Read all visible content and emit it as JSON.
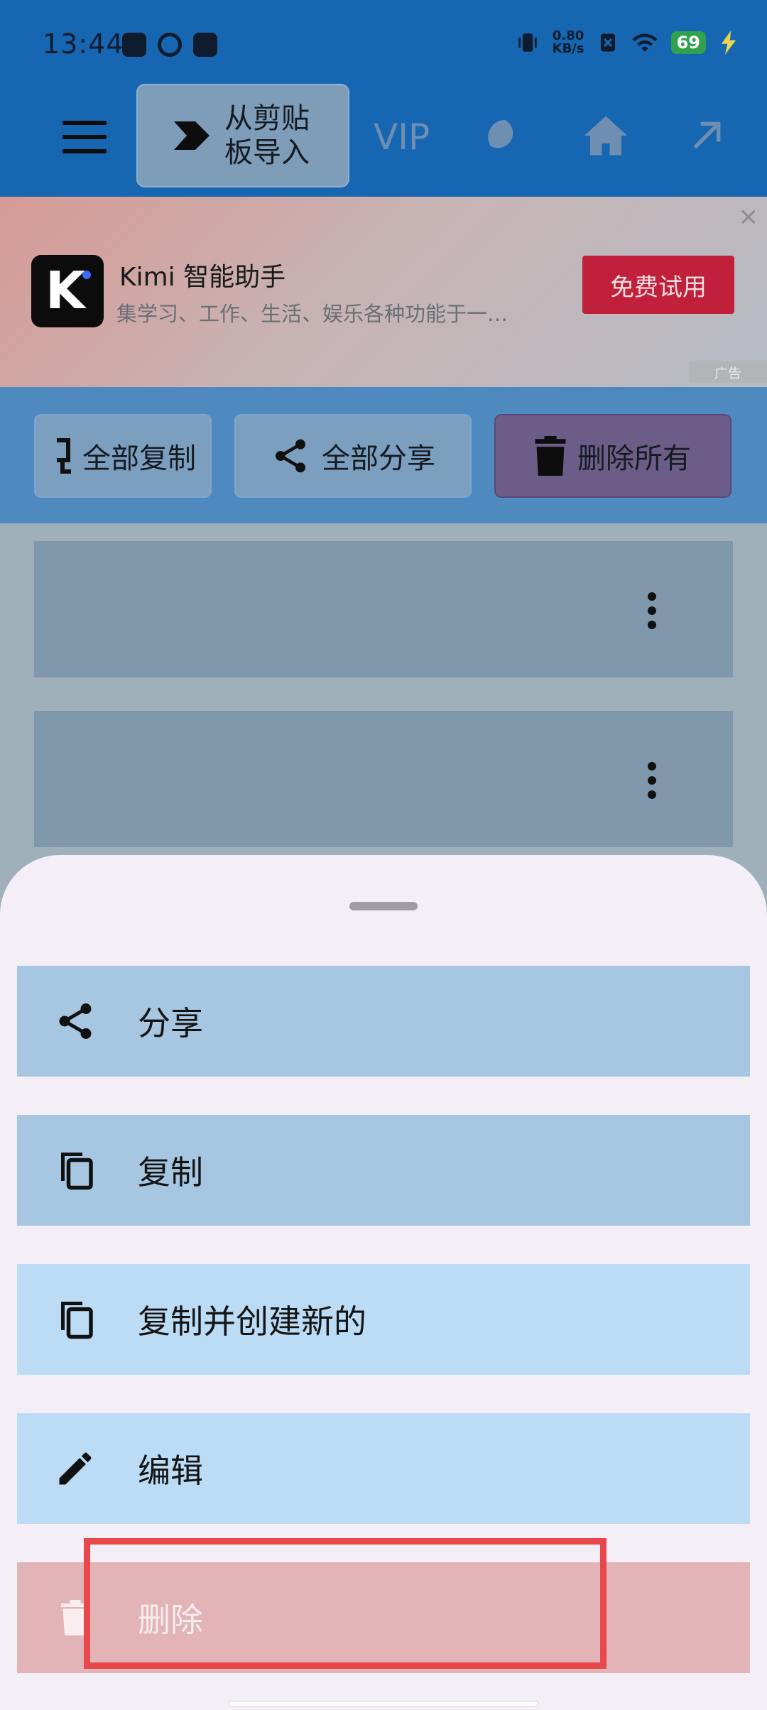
{
  "status_bar": {
    "time": "13:44",
    "net_speed_value": "0.80",
    "net_speed_unit": "KB/s",
    "battery": "69"
  },
  "toolbar": {
    "import_label": "从剪贴板导入",
    "vip_label": "VIP"
  },
  "ad": {
    "title": "Kimi 智能助手",
    "description": "集学习、工作、生活、娱乐各种功能于一…",
    "cta_label": "免费试用",
    "tag_label": "广告",
    "close_glyph": "×"
  },
  "actions": {
    "copy_all": "全部复制",
    "share_all": "全部分享",
    "delete_all": "删除所有"
  },
  "sheet": {
    "items": [
      {
        "label": "分享",
        "icon": "share-icon"
      },
      {
        "label": "复制",
        "icon": "copy-icon"
      },
      {
        "label": "复制并创建新的",
        "icon": "copy-icon"
      },
      {
        "label": "编辑",
        "icon": "edit-icon"
      },
      {
        "label": "删除",
        "icon": "trash-icon"
      }
    ]
  },
  "colors": {
    "header": "#1766b1",
    "cta": "#c0203a",
    "sheet_bg": "#f4eff7",
    "highlight": "#e8474b"
  }
}
